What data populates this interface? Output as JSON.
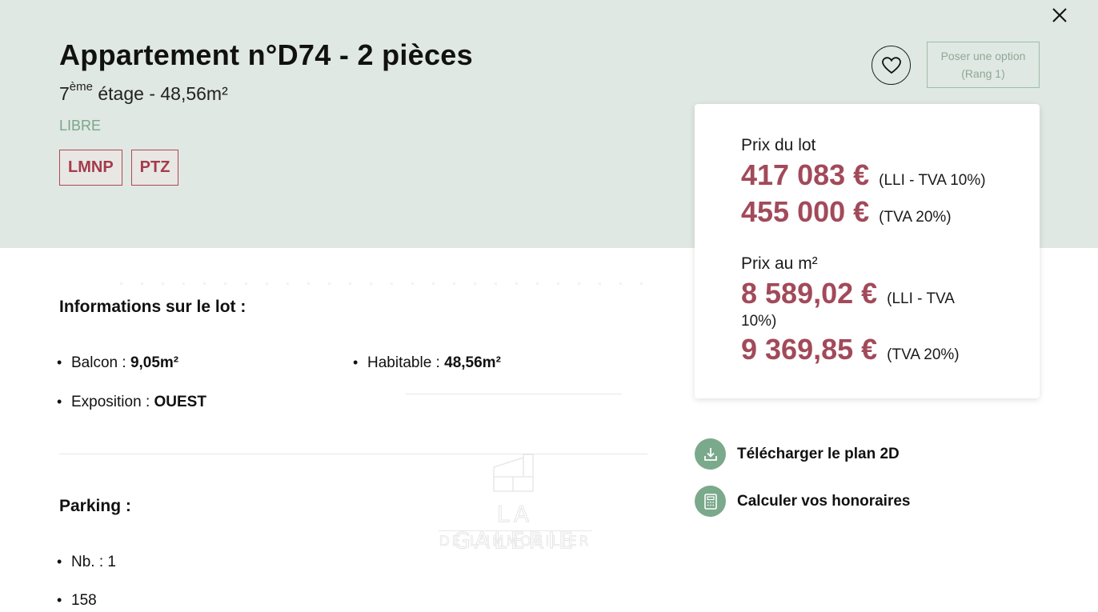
{
  "header": {
    "title": "Appartement n°D74 - 2 pièces",
    "floor_number": "7",
    "floor_suffix": "ème",
    "floor_rest": " étage - 48,56m²",
    "status": "LIBRE",
    "tags": [
      "LMNP",
      "PTZ"
    ],
    "option_button": {
      "line1": "Poser une option",
      "line2": "(Rang 1)"
    },
    "icons": {
      "close": "close-icon",
      "favorite": "heart-icon"
    }
  },
  "price_card": {
    "lot_label": "Prix du lot",
    "lot_prices": [
      {
        "amount": "417 083 €",
        "note": "(LLI - TVA 10%)"
      },
      {
        "amount": "455 000 €",
        "note": "(TVA 20%)"
      }
    ],
    "m2_label": "Prix au m²",
    "m2_prices": [
      {
        "amount": "8 589,02 €",
        "note": "(LLI - TVA",
        "note_wrap": "10%)"
      },
      {
        "amount": "9 369,85 €",
        "note": "(TVA 20%)"
      }
    ]
  },
  "info": {
    "title": "Informations sur le lot :",
    "items": [
      {
        "label": "Balcon : ",
        "value": "9,05m²"
      },
      {
        "label": "Habitable : ",
        "value": "48,56m²"
      },
      {
        "label": "Exposition : ",
        "value": "OUEST"
      }
    ]
  },
  "parking": {
    "title": "Parking :",
    "items": [
      "Nb. : 1",
      "158"
    ]
  },
  "watermark": {
    "line1": "LA GALERIE",
    "line2": "DE L'IMMOBILIER"
  },
  "actions": [
    {
      "label": "Télécharger le plan 2D",
      "icon": "download-icon"
    },
    {
      "label": "Calculer vos honoraires",
      "icon": "calculator-icon"
    }
  ],
  "colors": {
    "hero_bg": "#dfe8e2",
    "accent_price": "#a24a5a",
    "accent_green": "#7ba98b",
    "tag_border": "#b04858"
  }
}
